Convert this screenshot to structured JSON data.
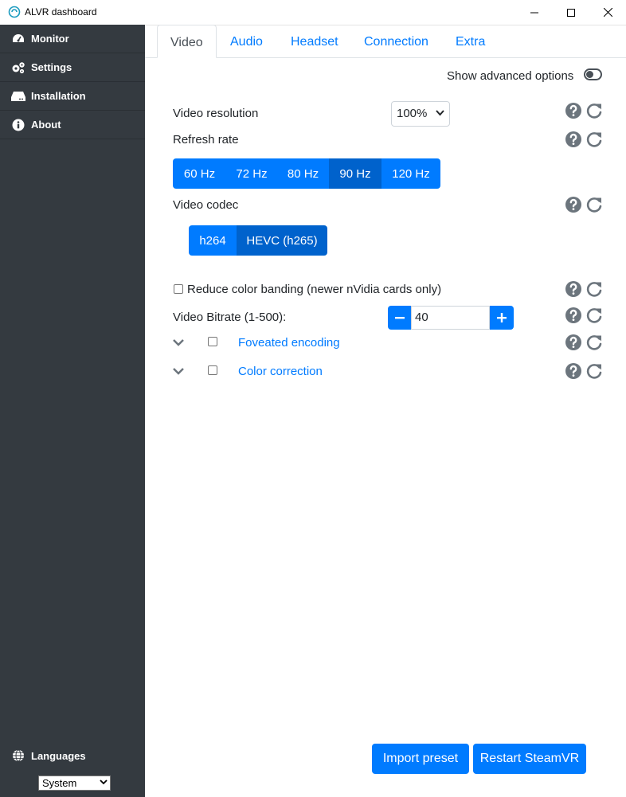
{
  "window": {
    "title": "ALVR dashboard"
  },
  "sidebar": {
    "items": [
      {
        "label": "Monitor",
        "icon": "gauge-icon"
      },
      {
        "label": "Settings",
        "icon": "gears-icon"
      },
      {
        "label": "Installation",
        "icon": "hdd-icon"
      },
      {
        "label": "About",
        "icon": "info-icon"
      }
    ],
    "languages_label": "Languages",
    "language_value": "System"
  },
  "tabs": [
    {
      "label": "Video",
      "active": true
    },
    {
      "label": "Audio"
    },
    {
      "label": "Headset"
    },
    {
      "label": "Connection"
    },
    {
      "label": "Extra"
    }
  ],
  "advanced": {
    "label": "Show advanced options",
    "enabled": false
  },
  "video": {
    "resolution_label": "Video resolution",
    "resolution_value": "100%",
    "refresh_label": "Refresh rate",
    "refresh_options": [
      "60 Hz",
      "72 Hz",
      "80 Hz",
      "90 Hz",
      "120 Hz"
    ],
    "refresh_selected": "90 Hz",
    "codec_label": "Video codec",
    "codec_options": [
      "h264",
      "HEVC (h265)"
    ],
    "codec_selected": "HEVC (h265)",
    "banding_label": "Reduce color banding (newer nVidia cards only)",
    "bitrate_label": "Video Bitrate (1-500):",
    "bitrate_value": "40",
    "foveated_label": "Foveated encoding",
    "color_correction_label": "Color correction"
  },
  "footer": {
    "import_label": "Import preset",
    "restart_label": "Restart SteamVR"
  },
  "colors": {
    "accent": "#007bff",
    "accent_selected": "#0062cc",
    "sidebar": "#343a40"
  }
}
